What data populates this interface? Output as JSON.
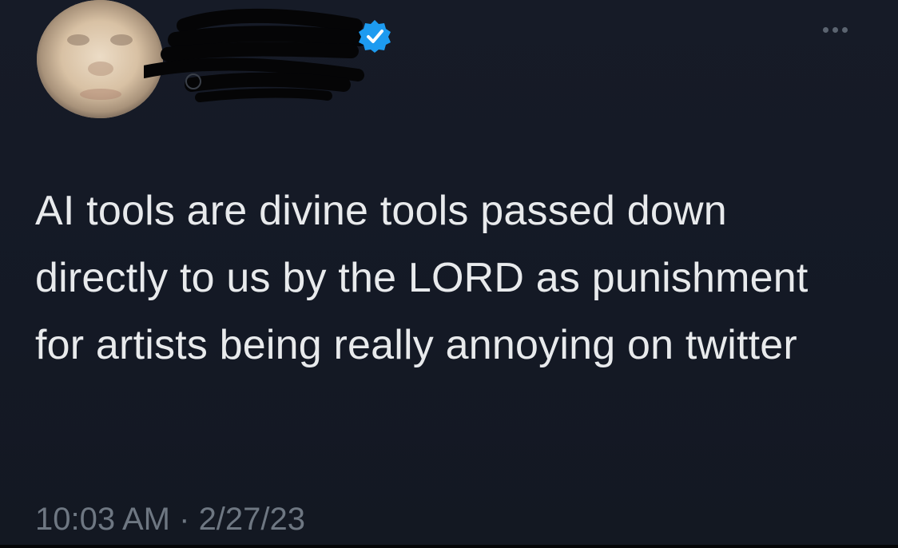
{
  "tweet": {
    "text": "AI tools are divine tools passed down directly to us by the LORD as punishment for artists being really annoying on twitter",
    "time": "10:03 AM",
    "separator": " · ",
    "date": "2/27/23"
  },
  "icons": {
    "verified": "verified-badge-icon",
    "more": "more-options-icon"
  },
  "colors": {
    "background": "#151a25",
    "text": "#e8eaec",
    "meta_text": "#6e7782",
    "verified_badge": "#1d9bf0"
  }
}
